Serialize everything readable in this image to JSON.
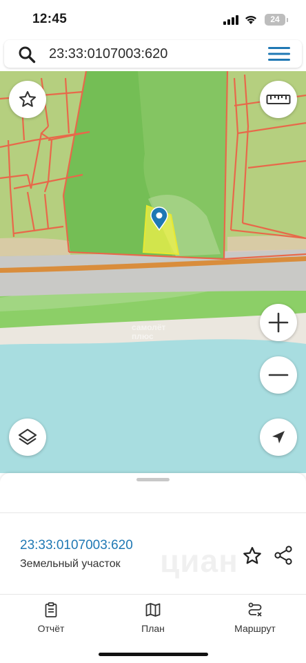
{
  "status_bar": {
    "time": "12:45",
    "battery": "24"
  },
  "search": {
    "query": "23:33:0107003:620"
  },
  "map": {
    "watermark_line1": "самолёт",
    "watermark_line2": "плюс",
    "marker_color": "#1f78b4",
    "parcel_highlight_color": "#f2f24a"
  },
  "sheet": {
    "parcel_number": "23:33:0107003:620",
    "parcel_type": "Земельный участок",
    "watermark": "циан"
  },
  "bottom_nav": {
    "items": [
      {
        "label": "Отчёт",
        "icon": "clipboard-icon"
      },
      {
        "label": "План",
        "icon": "map-icon"
      },
      {
        "label": "Маршрут",
        "icon": "route-icon"
      }
    ]
  },
  "colors": {
    "accent": "#1f78b4",
    "boundary": "#e8684a"
  }
}
